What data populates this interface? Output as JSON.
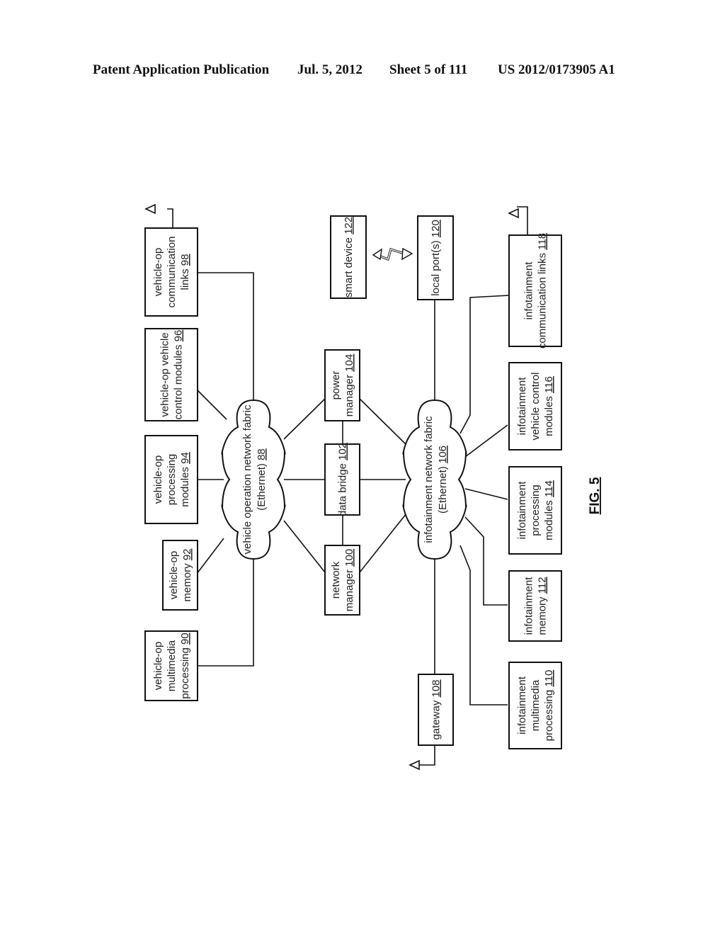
{
  "header": {
    "publication": "Patent Application Publication",
    "date": "Jul. 5, 2012",
    "sheet": "Sheet 5 of 111",
    "number": "US 2012/0173905 A1"
  },
  "figure": {
    "label": "FIG. 5",
    "clouds": [
      {
        "id": "vehicle-operation-network-fabric",
        "lines": [
          "vehicle operation network fabric",
          "(Ethernet) "
        ],
        "ref": "88"
      },
      {
        "id": "infotainment-network-fabric",
        "lines": [
          "infotainment network fabric",
          "(Ethernet) "
        ],
        "ref": "106"
      }
    ],
    "blocks": {
      "vop_comm_links": {
        "lines": [
          "vehicle-op",
          "communication",
          "links "
        ],
        "ref": "98"
      },
      "vop_vehicle_control": {
        "lines": [
          "vehicle-op vehicle",
          "control modules "
        ],
        "ref": "96"
      },
      "vop_processing": {
        "lines": [
          "vehicle-op",
          "processing",
          "modules "
        ],
        "ref": "94"
      },
      "vop_memory": {
        "lines": [
          "vehicle-op",
          "memory "
        ],
        "ref": "92"
      },
      "vop_multimedia": {
        "lines": [
          "vehicle-op",
          "multimedia",
          "processing "
        ],
        "ref": "90"
      },
      "power_manager": {
        "lines": [
          "power",
          "manager "
        ],
        "ref": "104"
      },
      "data_bridge": {
        "lines": [
          "data bridge "
        ],
        "ref": "102"
      },
      "network_manager": {
        "lines": [
          "network",
          "manager "
        ],
        "ref": "100"
      },
      "smart_device": {
        "lines": [
          "smart device "
        ],
        "ref": "122"
      },
      "local_ports": {
        "lines": [
          "local port(s) "
        ],
        "ref": "120"
      },
      "gateway": {
        "lines": [
          "gateway "
        ],
        "ref": "108"
      },
      "info_comm_links": {
        "lines": [
          "infotainment",
          "communication links "
        ],
        "ref": "118"
      },
      "info_vehicle_control": {
        "lines": [
          "infotainment",
          "vehicle control",
          "modules "
        ],
        "ref": "116"
      },
      "info_processing": {
        "lines": [
          "infotainment",
          "processing",
          "modules "
        ],
        "ref": "114"
      },
      "info_memory": {
        "lines": [
          "infotainment",
          "memory "
        ],
        "ref": "112"
      },
      "info_multimedia": {
        "lines": [
          "infotainment",
          "multimedia",
          "processing "
        ],
        "ref": "110"
      }
    }
  }
}
